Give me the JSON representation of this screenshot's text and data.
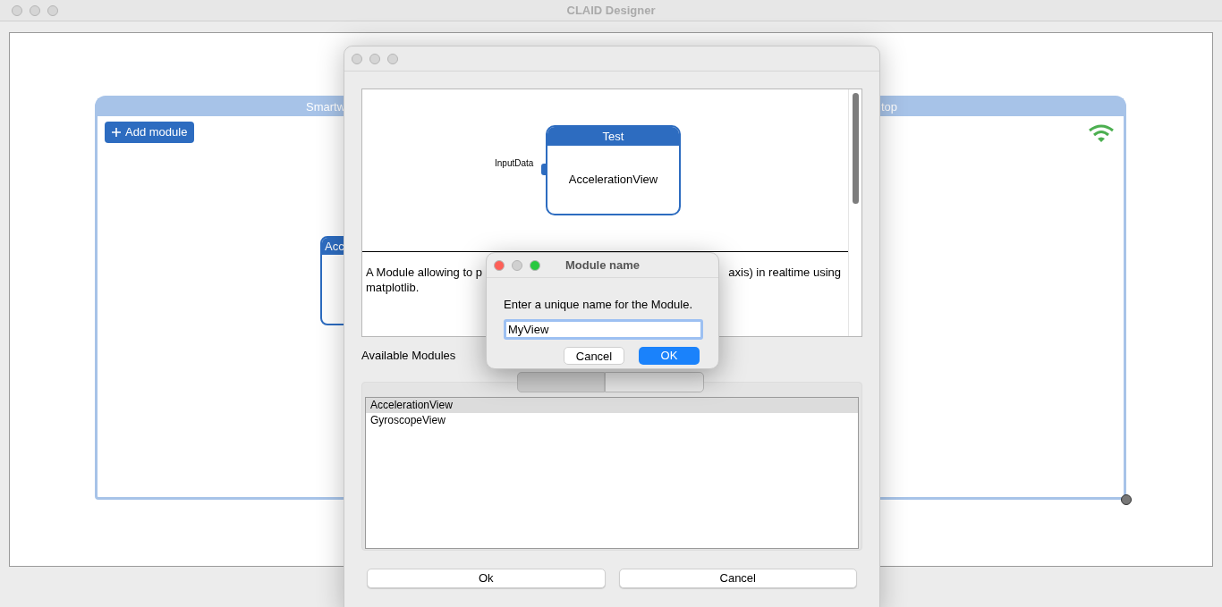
{
  "app": {
    "title": "CLAID Designer"
  },
  "canvas": {
    "device": {
      "title_parts": [
        "Smartw",
        "top"
      ],
      "add_button": "Add module",
      "connected": true
    },
    "nodes": [
      {
        "title": "Acc"
      }
    ]
  },
  "module_dialog": {
    "preview": {
      "node_title": "Test",
      "node_type": "AccelerationView",
      "input": "InputData"
    },
    "description": {
      "line_start": "A Module allowing to p",
      "line_end": "axis) in realtime using",
      "line_2": "matplotlib."
    },
    "list_label": "Available Modules",
    "tabs": [
      {
        "selected": true
      },
      {
        "selected": false
      }
    ],
    "modules": [
      {
        "name": "AccelerationView",
        "selected": true
      },
      {
        "name": "GyroscopeView",
        "selected": false
      }
    ],
    "buttons": [
      "Ok",
      "Cancel"
    ]
  },
  "name_dialog": {
    "title": "Module name",
    "prompt": "Enter a unique name for the Module.",
    "value": "MyView",
    "buttons": [
      {
        "label": "Cancel",
        "kind": "secondary"
      },
      {
        "label": "OK",
        "kind": "primary"
      }
    ]
  }
}
